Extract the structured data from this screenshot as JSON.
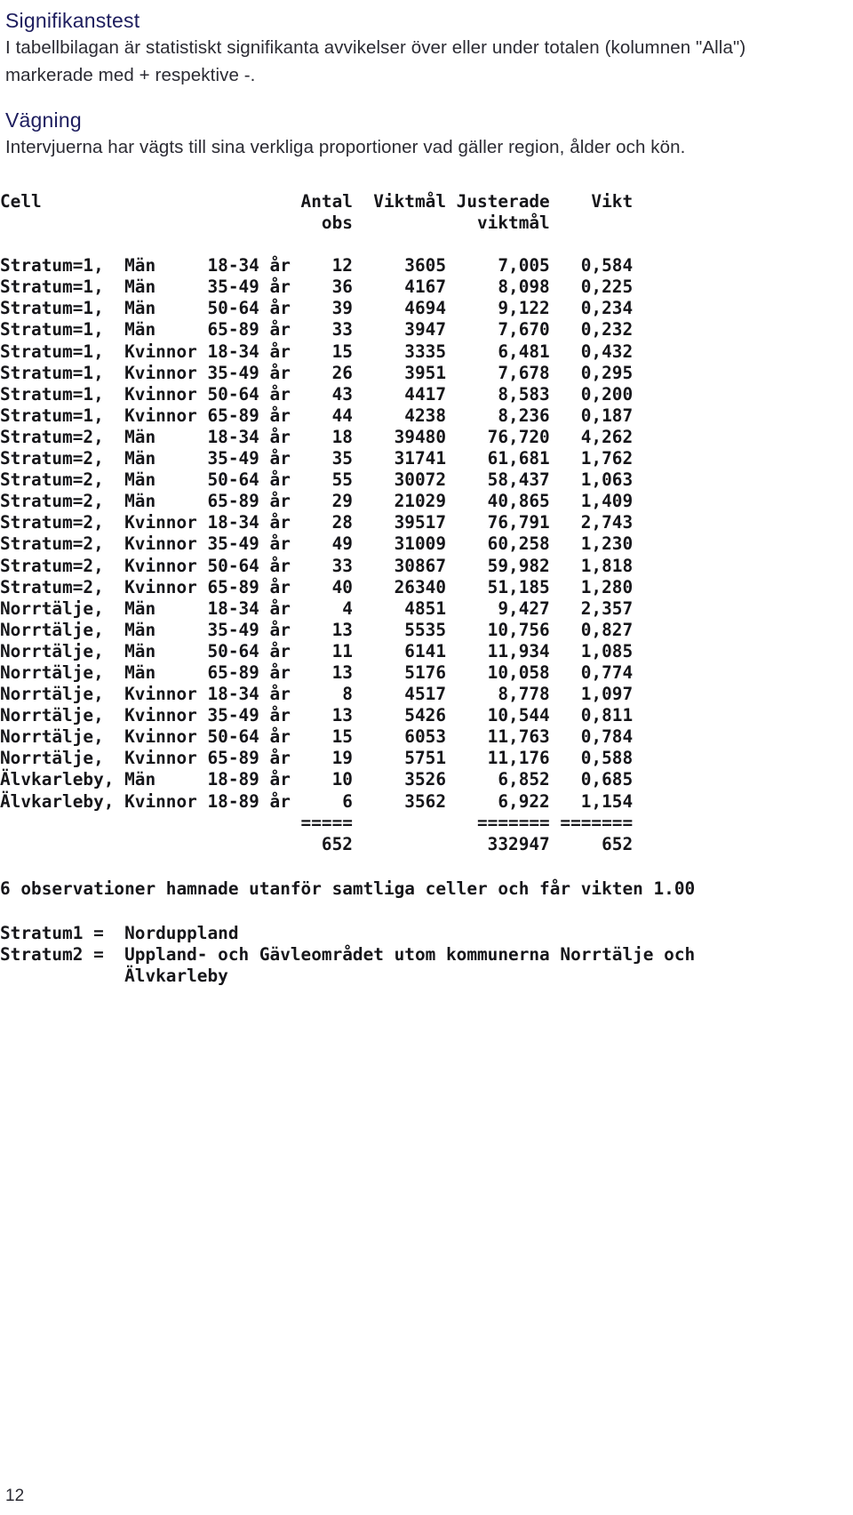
{
  "sections": {
    "significance": {
      "heading": "Signifikanstest",
      "paragraph": "I tabellbilagan är statistiskt signifikanta avvikelser över eller under totalen (kolumnen \"Alla\") markerade med + respektive -."
    },
    "weighting": {
      "heading": "Vägning",
      "paragraph": "Intervjuerna har vägts till sina verkliga proportioner vad gäller region, ålder och kön."
    }
  },
  "table": {
    "headers": {
      "line1": [
        "Cell",
        "Antal",
        "Viktmål",
        "Justerade",
        "Vikt"
      ],
      "line2": [
        "obs",
        "viktmål"
      ],
      "cell": "Cell",
      "antal": "Antal",
      "obs": "obs",
      "viktmal": "Viktmål",
      "justerade": "Justerade",
      "justerade_viktmal": "viktmål",
      "vikt": "Vikt"
    },
    "rows": [
      {
        "cell": "Stratum=1,",
        "kon": "Män",
        "alder": "18-34 år",
        "antal_obs": "12",
        "viktmal": "3605",
        "justerat_viktmal": "7,005",
        "vikt": "0,584"
      },
      {
        "cell": "Stratum=1,",
        "kon": "Män",
        "alder": "35-49 år",
        "antal_obs": "36",
        "viktmal": "4167",
        "justerat_viktmal": "8,098",
        "vikt": "0,225"
      },
      {
        "cell": "Stratum=1,",
        "kon": "Män",
        "alder": "50-64 år",
        "antal_obs": "39",
        "viktmal": "4694",
        "justerat_viktmal": "9,122",
        "vikt": "0,234"
      },
      {
        "cell": "Stratum=1,",
        "kon": "Män",
        "alder": "65-89 år",
        "antal_obs": "33",
        "viktmal": "3947",
        "justerat_viktmal": "7,670",
        "vikt": "0,232"
      },
      {
        "cell": "Stratum=1,",
        "kon": "Kvinnor",
        "alder": "18-34 år",
        "antal_obs": "15",
        "viktmal": "3335",
        "justerat_viktmal": "6,481",
        "vikt": "0,432"
      },
      {
        "cell": "Stratum=1,",
        "kon": "Kvinnor",
        "alder": "35-49 år",
        "antal_obs": "26",
        "viktmal": "3951",
        "justerat_viktmal": "7,678",
        "vikt": "0,295"
      },
      {
        "cell": "Stratum=1,",
        "kon": "Kvinnor",
        "alder": "50-64 år",
        "antal_obs": "43",
        "viktmal": "4417",
        "justerat_viktmal": "8,583",
        "vikt": "0,200"
      },
      {
        "cell": "Stratum=1,",
        "kon": "Kvinnor",
        "alder": "65-89 år",
        "antal_obs": "44",
        "viktmal": "4238",
        "justerat_viktmal": "8,236",
        "vikt": "0,187"
      },
      {
        "cell": "Stratum=2,",
        "kon": "Män",
        "alder": "18-34 år",
        "antal_obs": "18",
        "viktmal": "39480",
        "justerat_viktmal": "76,720",
        "vikt": "4,262"
      },
      {
        "cell": "Stratum=2,",
        "kon": "Män",
        "alder": "35-49 år",
        "antal_obs": "35",
        "viktmal": "31741",
        "justerat_viktmal": "61,681",
        "vikt": "1,762"
      },
      {
        "cell": "Stratum=2,",
        "kon": "Män",
        "alder": "50-64 år",
        "antal_obs": "55",
        "viktmal": "30072",
        "justerat_viktmal": "58,437",
        "vikt": "1,063"
      },
      {
        "cell": "Stratum=2,",
        "kon": "Män",
        "alder": "65-89 år",
        "antal_obs": "29",
        "viktmal": "21029",
        "justerat_viktmal": "40,865",
        "vikt": "1,409"
      },
      {
        "cell": "Stratum=2,",
        "kon": "Kvinnor",
        "alder": "18-34 år",
        "antal_obs": "28",
        "viktmal": "39517",
        "justerat_viktmal": "76,791",
        "vikt": "2,743"
      },
      {
        "cell": "Stratum=2,",
        "kon": "Kvinnor",
        "alder": "35-49 år",
        "antal_obs": "49",
        "viktmal": "31009",
        "justerat_viktmal": "60,258",
        "vikt": "1,230"
      },
      {
        "cell": "Stratum=2,",
        "kon": "Kvinnor",
        "alder": "50-64 år",
        "antal_obs": "33",
        "viktmal": "30867",
        "justerat_viktmal": "59,982",
        "vikt": "1,818"
      },
      {
        "cell": "Stratum=2,",
        "kon": "Kvinnor",
        "alder": "65-89 år",
        "antal_obs": "40",
        "viktmal": "26340",
        "justerat_viktmal": "51,185",
        "vikt": "1,280"
      },
      {
        "cell": "Norrtälje,",
        "kon": "Män",
        "alder": "18-34 år",
        "antal_obs": "4",
        "viktmal": "4851",
        "justerat_viktmal": "9,427",
        "vikt": "2,357"
      },
      {
        "cell": "Norrtälje,",
        "kon": "Män",
        "alder": "35-49 år",
        "antal_obs": "13",
        "viktmal": "5535",
        "justerat_viktmal": "10,756",
        "vikt": "0,827"
      },
      {
        "cell": "Norrtälje,",
        "kon": "Män",
        "alder": "50-64 år",
        "antal_obs": "11",
        "viktmal": "6141",
        "justerat_viktmal": "11,934",
        "vikt": "1,085"
      },
      {
        "cell": "Norrtälje,",
        "kon": "Män",
        "alder": "65-89 år",
        "antal_obs": "13",
        "viktmal": "5176",
        "justerat_viktmal": "10,058",
        "vikt": "0,774"
      },
      {
        "cell": "Norrtälje,",
        "kon": "Kvinnor",
        "alder": "18-34 år",
        "antal_obs": "8",
        "viktmal": "4517",
        "justerat_viktmal": "8,778",
        "vikt": "1,097"
      },
      {
        "cell": "Norrtälje,",
        "kon": "Kvinnor",
        "alder": "35-49 år",
        "antal_obs": "13",
        "viktmal": "5426",
        "justerat_viktmal": "10,544",
        "vikt": "0,811"
      },
      {
        "cell": "Norrtälje,",
        "kon": "Kvinnor",
        "alder": "50-64 år",
        "antal_obs": "15",
        "viktmal": "6053",
        "justerat_viktmal": "11,763",
        "vikt": "0,784"
      },
      {
        "cell": "Norrtälje,",
        "kon": "Kvinnor",
        "alder": "65-89 år",
        "antal_obs": "19",
        "viktmal": "5751",
        "justerat_viktmal": "11,176",
        "vikt": "0,588"
      },
      {
        "cell": "Älvkarleby,",
        "kon": "Män",
        "alder": "18-89 år",
        "antal_obs": "10",
        "viktmal": "3526",
        "justerat_viktmal": "6,852",
        "vikt": "0,685"
      },
      {
        "cell": "Älvkarleby,",
        "kon": "Kvinnor",
        "alder": "18-89 år",
        "antal_obs": "6",
        "viktmal": "3562",
        "justerat_viktmal": "6,922",
        "vikt": "1,154"
      }
    ],
    "rule_line": "                                           =====                   ======= =======",
    "totals": {
      "antal_obs": "652",
      "justerat_viktmal": "332947",
      "vikt": "652"
    },
    "totals_line": "                                             652                    332947     652"
  },
  "note": "6 observationer hamnade utanför samtliga celler och får vikten 1.00",
  "definitions": [
    {
      "label": "Stratum1 =",
      "value": "Norduppland"
    },
    {
      "label": "Stratum2 =",
      "value": "Uppland- och Gävleområdet utom kommunerna Norrtälje och",
      "value_cont": "Älvkarleby"
    }
  ],
  "footer": {
    "page_number": "12"
  },
  "colors": {
    "heading": "#1d1d5e",
    "body": "#2b2b33",
    "mono": "#16161a",
    "background": "#ffffff"
  }
}
